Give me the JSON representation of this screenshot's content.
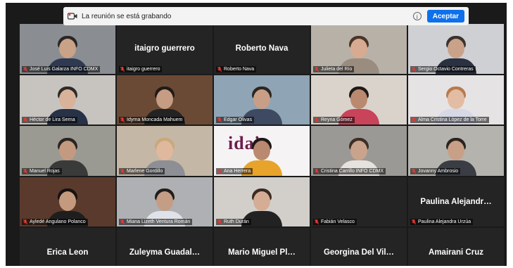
{
  "banner": {
    "text": "La reunión se está grabando",
    "accept_label": "Aceptar"
  },
  "tiles": [
    {
      "name": "José Luis Galarza INFO CDMX",
      "display_name": "",
      "video": true,
      "bg": "#8a8e93",
      "skin": "#c9a288",
      "hair": "#2a2624",
      "shirt": "#2f3a52"
    },
    {
      "name": "itaigro guerrero",
      "display_name": "itaigro guerrero",
      "video": false
    },
    {
      "name": "Roberto Nava",
      "display_name": "Roberto Nava",
      "video": false
    },
    {
      "name": "Julieta del Río",
      "display_name": "",
      "video": true,
      "active": true,
      "bg": "#b7b1a8",
      "skin": "#d7ab92",
      "hair": "#4a3528",
      "shirt": "#9a8d80"
    },
    {
      "name": "Sergio Octavio Contreras",
      "display_name": "",
      "video": true,
      "bg": "#cfd0d4",
      "skin": "#caa28a",
      "hair": "#3a332f",
      "shirt": "#2a3140"
    },
    {
      "name": "Héctor de Lira Serna",
      "display_name": "",
      "video": true,
      "bg": "#c7c4c0",
      "skin": "#d8b39a",
      "hair": "#2e2a28",
      "shirt": "#283246"
    },
    {
      "name": "Idyrna Moncada Mahuem",
      "display_name": "",
      "video": true,
      "bg": "#6b4a35",
      "skin": "#c69c82",
      "hair": "#1f1a18",
      "shirt": "#232323"
    },
    {
      "name": "Edgar Olivas",
      "display_name": "",
      "video": true,
      "bg": "#8fa4b4",
      "skin": "#c89f86",
      "hair": "#2b2622",
      "shirt": "#3e4a62"
    },
    {
      "name": "Reyna Gómez",
      "display_name": "",
      "video": true,
      "bg": "#d9d3cc",
      "skin": "#b98a70",
      "hair": "#1e1816",
      "shirt": "#c9435a"
    },
    {
      "name": "Alma Cristina López de la Torre",
      "display_name": "",
      "video": true,
      "bg": "#e6e3e4",
      "skin": "#e2bca3",
      "hair": "#b87a4c",
      "shirt": "#d6d8e6"
    },
    {
      "name": "Manuel Rojas",
      "display_name": "",
      "video": true,
      "bg": "#9a9992",
      "skin": "#c39a7f",
      "hair": "#2a2420",
      "shirt": "#3a3a3a"
    },
    {
      "name": "Marlene Gordillo",
      "display_name": "",
      "video": true,
      "bg": "#c4b7a6",
      "skin": "#e0b89e",
      "hair": "#c9a879",
      "shirt": "#8d8f95"
    },
    {
      "name": "Ana Herrera",
      "display_name": "",
      "video": true,
      "logo": true,
      "logo_text": "idaip",
      "bg": "#f6f3f5",
      "skin": "#b98a70",
      "hair": "#1e1816",
      "shirt": "#e8a32a"
    },
    {
      "name": "Cristina Carrillo INFO CDMX",
      "display_name": "",
      "video": true,
      "bg": "#9b9995",
      "skin": "#c9a38c",
      "hair": "#3d2e26",
      "shirt": "#e6e2dd"
    },
    {
      "name": "Jovanny Ambrosio",
      "display_name": "",
      "video": true,
      "bg": "#b5b3ae",
      "skin": "#c8a088",
      "hair": "#2a2420",
      "shirt": "#3a3d44"
    },
    {
      "name": "Ayledé Angulano Polanco",
      "display_name": "",
      "video": true,
      "bg": "#5a3a2c",
      "skin": "#c49a7e",
      "hair": "#151212",
      "shirt": "#1e1e1e"
    },
    {
      "name": "Miana Lizeth Ventura Román",
      "display_name": "",
      "video": true,
      "bg": "#aeb0b3",
      "skin": "#c49d85",
      "hair": "#221d1a",
      "shirt": "#dfe2e8"
    },
    {
      "name": "Ruth Durán",
      "display_name": "",
      "video": true,
      "bg": "#d2cfcb",
      "skin": "#d5ad94",
      "hair": "#3a2a22",
      "shirt": "#222222"
    },
    {
      "name": "Fabián Velasco",
      "display_name": "",
      "video": false
    },
    {
      "name": "Paulina Alejandra Urzúa",
      "display_name": "Paulina Alejandr…",
      "video": false
    },
    {
      "name": "",
      "display_name": "Erica Leon",
      "video": false
    },
    {
      "name": "",
      "display_name": "Zuleyma Guadal…",
      "video": false
    },
    {
      "name": "",
      "display_name": "Mario Miguel Pl…",
      "video": false
    },
    {
      "name": "",
      "display_name": "Georgina Del Vil…",
      "video": false
    },
    {
      "name": "",
      "display_name": "Amairani Cruz",
      "video": false
    }
  ],
  "colors": {
    "muted_mic": "#e53935",
    "active_speaker": "#3bbd5a",
    "accept_button": "#0e71eb"
  },
  "icons": {
    "recording": "recording-icon",
    "info": "info-icon",
    "muted": "mic-muted-icon"
  }
}
